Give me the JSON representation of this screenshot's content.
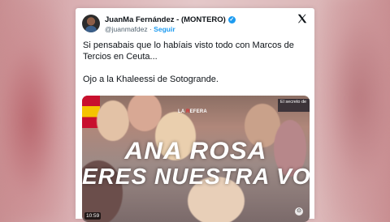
{
  "post": {
    "author_name": "JuanMa Fernández - (MONTERO)",
    "handle": "@juanmafdez",
    "separator": "·",
    "follow_label": "Seguir",
    "text_line1": "Si pensabais que lo habíais visto todo con Marcos de Tercios en Ceuta...",
    "text_line2": "Ojo a la Khaleessi de Sotogrande."
  },
  "media": {
    "overlay_line1": "ANA ROSA",
    "overlay_line2": "ERES NUESTRA VOZ",
    "tv_logo_prefix": "LA ",
    "tv_logo_mark": "R",
    "tv_logo_suffix": "EFERA",
    "corner_label": "El secreto de",
    "timestamp": "10:59"
  },
  "colors": {
    "accent": "#1d9bf0",
    "text": "#0f1419",
    "muted": "#536471"
  },
  "icons": {
    "verified": "verified-badge-icon",
    "platform": "x-logo-icon",
    "media_action": "media-icon"
  }
}
